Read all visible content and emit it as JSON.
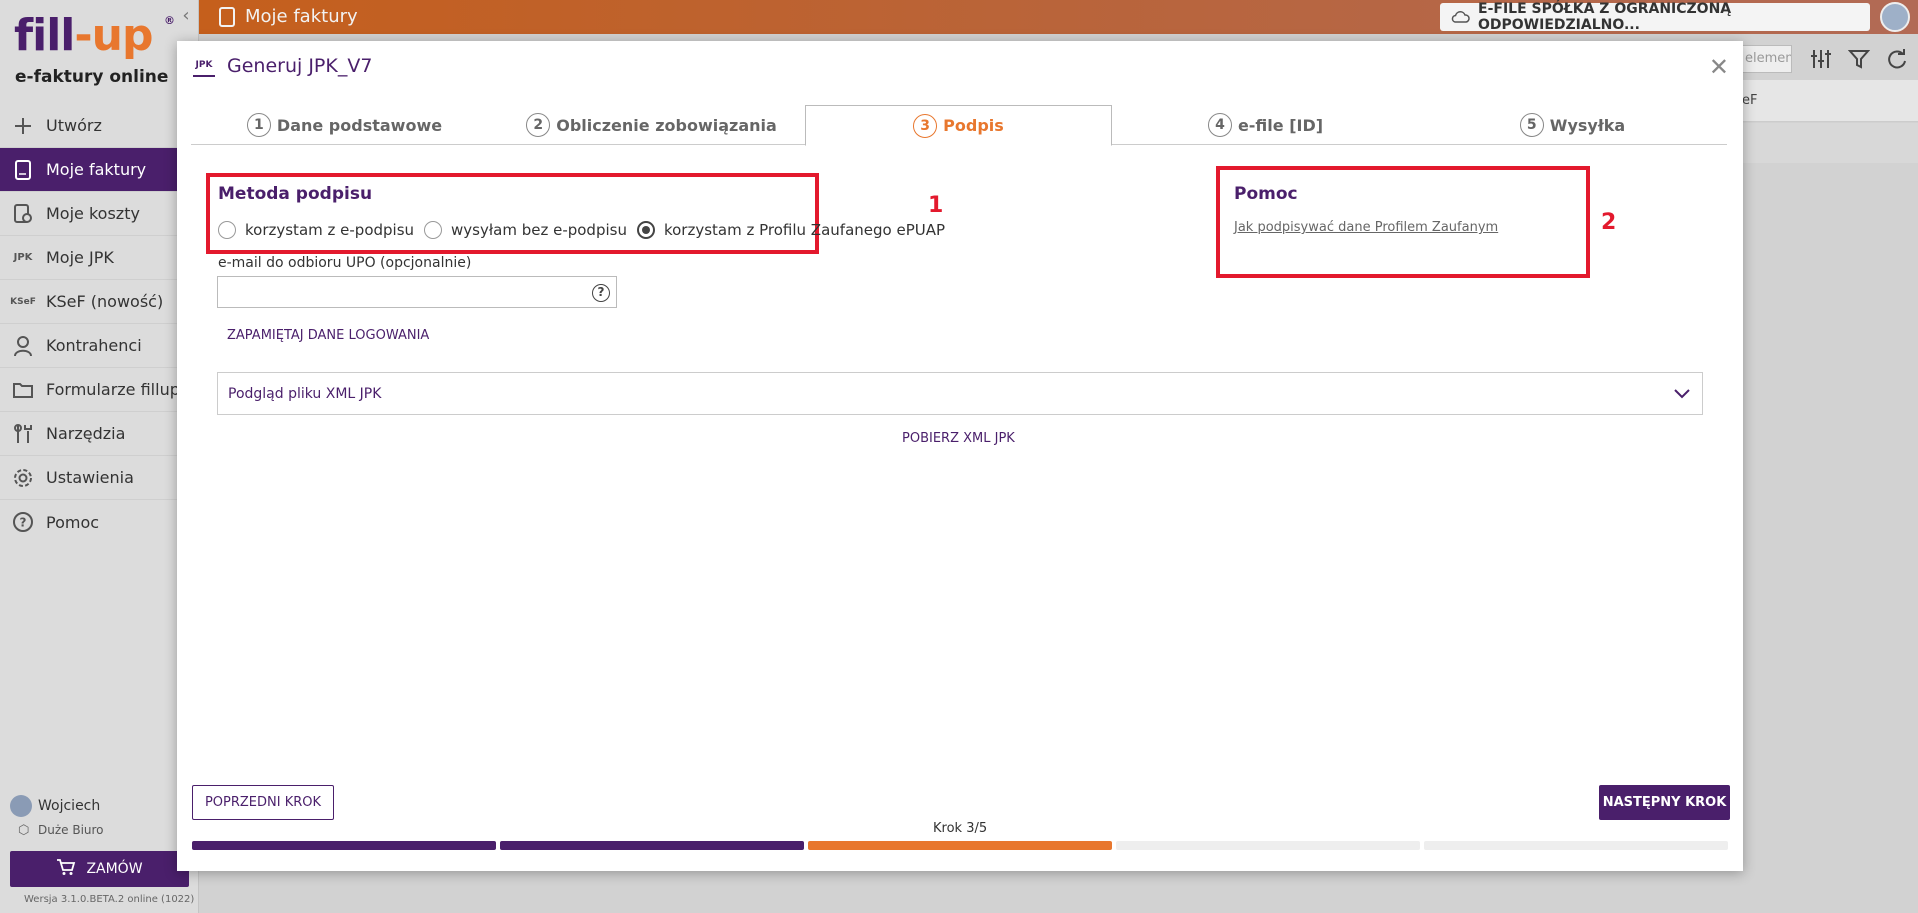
{
  "app": {
    "logo_main": "fill",
    "logo_dash": "-",
    "logo_up": "up",
    "logo_reg": "®",
    "subtitle": "e-faktury online"
  },
  "sidebar": {
    "items": [
      {
        "label": "Utwórz",
        "icon": "plus-icon"
      },
      {
        "label": "Moje faktury",
        "icon": "invoice-icon"
      },
      {
        "label": "Moje koszty",
        "icon": "costs-icon"
      },
      {
        "label": "Moje JPK",
        "icon": "jpk-icon"
      },
      {
        "label": "KSeF (nowość)",
        "icon": "ksef-icon"
      },
      {
        "label": "Kontrahenci",
        "icon": "person-icon"
      },
      {
        "label": "Formularze fillup",
        "icon": "folder-icon"
      },
      {
        "label": "Narzędzia",
        "icon": "tools-icon"
      },
      {
        "label": "Ustawienia",
        "icon": "gear-icon"
      },
      {
        "label": "Pomoc",
        "icon": "help-icon"
      }
    ],
    "user_name": "Wojciech",
    "office_name": "Duże Biuro",
    "order_label": "ZAMÓW",
    "version": "Wersja 3.1.0.BETA.2 online (1022)"
  },
  "topbar": {
    "title": "Moje faktury",
    "company": "E-FILE SPÓŁKA Z OGRANICZONĄ ODPOWIEDZIALNO..."
  },
  "background": {
    "search_placeholder": "elemen",
    "column_header": "eF"
  },
  "modal": {
    "badge": "JPK",
    "title": "Generuj JPK_V7",
    "tabs": [
      {
        "num": "1",
        "label": "Dane podstawowe"
      },
      {
        "num": "2",
        "label": "Obliczenie zobowiązania"
      },
      {
        "num": "3",
        "label": "Podpis"
      },
      {
        "num": "4",
        "label": "e-file [ID]"
      },
      {
        "num": "5",
        "label": "Wysyłka"
      }
    ],
    "active_tab": 3,
    "signature": {
      "title": "Metoda podpisu",
      "options": [
        "korzystam z e-podpisu",
        "wysyłam bez e-podpisu",
        "korzystam z Profilu Zaufanego ePUAP"
      ],
      "selected": "korzystam z Profilu Zaufanego ePUAP"
    },
    "help": {
      "title": "Pomoc",
      "link": "Jak podpisywać dane Profilem Zaufanym"
    },
    "annotations": {
      "one": "1",
      "two": "2"
    },
    "email_label": "e-mail do odbioru UPO (opcjonalnie)",
    "email_value": "",
    "remember_label": "ZAPAMIĘTAJ DANE LOGOWANIA",
    "xml_preview_label": "Podgląd pliku XML JPK",
    "download_label": "POBIERZ XML JPK",
    "prev_label": "POPRZEDNI KROK",
    "next_label": "NASTĘPNY KROK",
    "step_label": "Krok 3/5",
    "progress": {
      "current": 3,
      "total": 5
    }
  },
  "colors": {
    "brand_purple": "#4a1f6b",
    "brand_orange": "#e8772e",
    "annotation_red": "#e3192d",
    "progress_empty": "#eeeeee"
  }
}
